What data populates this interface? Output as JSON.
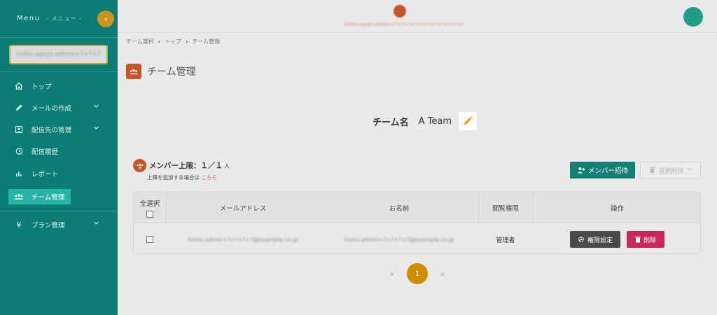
{
  "sidebar": {
    "menu_title": "Menu",
    "menu_subtitle": "- メニュー -",
    "collapse_glyph": "‹",
    "account_name": "hisho.agsys.admin+?+?+?",
    "items": [
      {
        "label": "トップ",
        "icon": "home-icon",
        "has_submenu": false
      },
      {
        "label": "メールの作成",
        "icon": "pencil-icon",
        "has_submenu": true
      },
      {
        "label": "配信先の管理",
        "icon": "contact-card-icon",
        "has_submenu": true
      },
      {
        "label": "配信履歴",
        "icon": "history-icon",
        "has_submenu": false
      },
      {
        "label": "レポート",
        "icon": "bar-chart-icon",
        "has_submenu": false
      },
      {
        "label": "チーム管理",
        "icon": "team-icon",
        "has_submenu": false,
        "active": true
      },
      {
        "label": "プラン管理",
        "icon": "yen-icon",
        "has_submenu": true
      }
    ]
  },
  "header": {
    "logo_text": "hisho.agsys.admin+?+?+?+?+?+?+?+?+?+?+?"
  },
  "breadcrumb": [
    "チーム選択",
    "トップ",
    "チーム管理"
  ],
  "page": {
    "title": "チーム管理",
    "team_label": "チーム名",
    "team_name": "A Team"
  },
  "limit": {
    "label": "メンバー上限：１／１",
    "unit": "人",
    "note_prefix": "上限を追加する場合は",
    "note_link": "こちら"
  },
  "actions": {
    "invite_label": "メンバー招待",
    "bulk_delete_label": "選択削除"
  },
  "table": {
    "headers": {
      "select_all": "全選択",
      "email": "メールアドレス",
      "name": "お名前",
      "permission": "閲覧権限",
      "actions": "操作"
    },
    "rows": [
      {
        "email": "hisho.admin+?+?+?+?@example.co.jp",
        "name": "hisho.admin+?+?+?+?@example.co.jp",
        "permission": "管理者",
        "perm_button": "権限設定",
        "delete_button": "削除"
      }
    ]
  },
  "pagination": {
    "prev": "«",
    "current": "1",
    "next": "»"
  },
  "colors": {
    "sidebar_bg": "#0b7d74",
    "accent_orange": "#c4542a",
    "page_active": "#d18b00",
    "delete_red": "#c8285c",
    "invite_green": "#167f75"
  }
}
